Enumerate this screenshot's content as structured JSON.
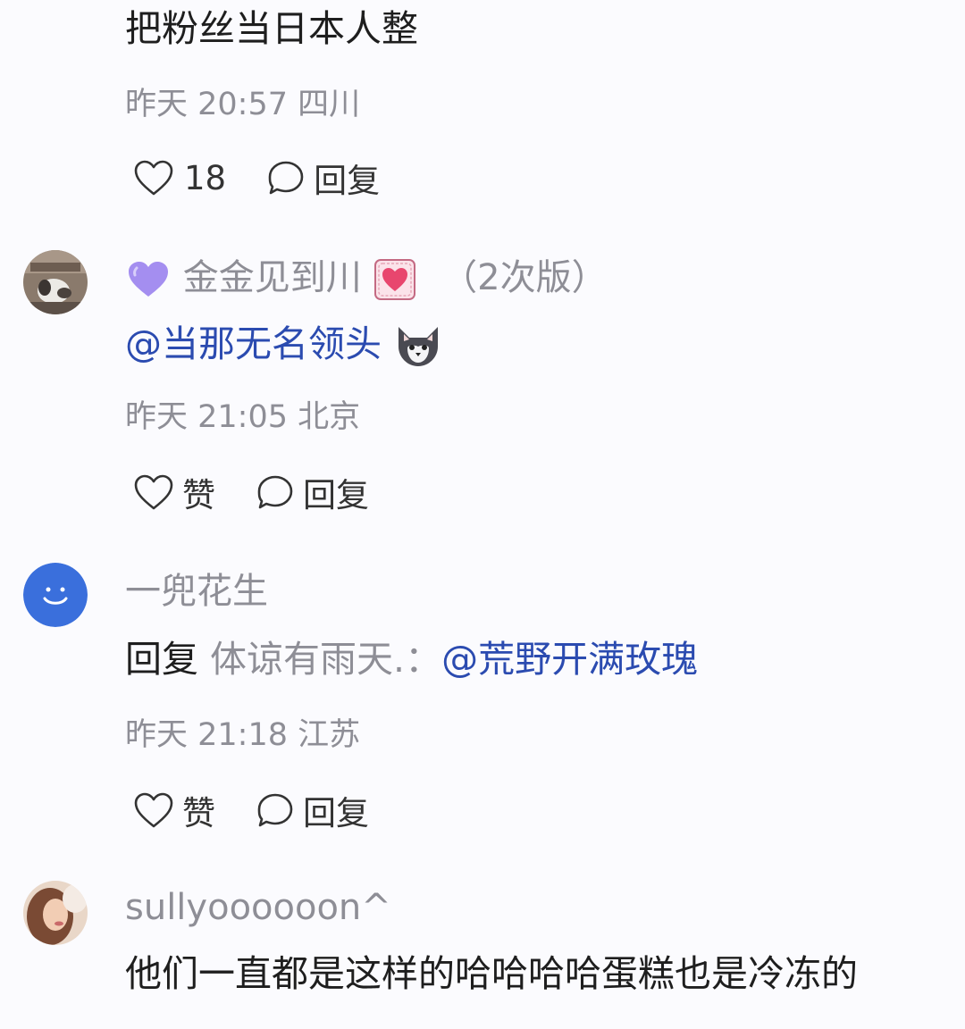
{
  "comments": [
    {
      "text": "把粉丝当日本人整",
      "time": "昨天 20:57",
      "location": "四川",
      "likes": "18",
      "reply_label": "回复"
    },
    {
      "username": "金金见到川",
      "edition": "（2次版）",
      "mention": "@当那无名领头",
      "time": "昨天 21:05",
      "location": "北京",
      "like_label": "赞",
      "reply_label": "回复",
      "icons": [
        "purple-heart-icon",
        "pink-heart-badge-icon",
        "wolf-icon"
      ]
    },
    {
      "username": "一兜花生",
      "reply_prefix": "回复",
      "reply_target": "体谅有雨天.：",
      "mention": "@荒野开满玫瑰",
      "time": "昨天 21:18",
      "location": "江苏",
      "like_label": "赞",
      "reply_label": "回复"
    },
    {
      "username": "sullyoooooon^",
      "text": "他们一直都是这样的哈哈哈哈蛋糕也是冷冻的"
    }
  ],
  "colors": {
    "mention": "#2b4bb0",
    "meta": "#8e8e96",
    "avatar_blue": "#3a6fdc",
    "purple_heart": "#a48ef0"
  }
}
